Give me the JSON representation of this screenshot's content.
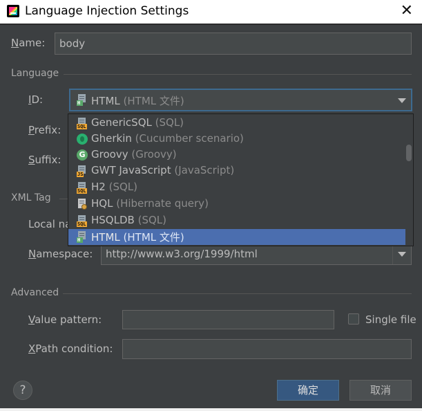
{
  "window": {
    "title": "Language Injection Settings"
  },
  "name": {
    "label": "Name:",
    "value": "body"
  },
  "language": {
    "section": "Language",
    "id_label": "ID:",
    "prefix_label": "Prefix:",
    "suffix_label": "Suffix:",
    "selected": {
      "name": "HTML",
      "hint": "(HTML 文件)"
    },
    "options": [
      {
        "name": "GenericSQL",
        "hint": "(SQL)",
        "icon": "sql-file-icon"
      },
      {
        "name": "Gherkin",
        "hint": "(Cucumber scenario)",
        "icon": "gherkin-icon"
      },
      {
        "name": "Groovy",
        "hint": "(Groovy)",
        "icon": "groovy-icon"
      },
      {
        "name": "GWT JavaScript",
        "hint": "(JavaScript)",
        "icon": "js-file-icon"
      },
      {
        "name": "H2",
        "hint": "(SQL)",
        "icon": "sql-file-icon"
      },
      {
        "name": "HQL",
        "hint": "(Hibernate query)",
        "icon": "hql-file-icon"
      },
      {
        "name": "HSQLDB",
        "hint": "(SQL)",
        "icon": "sql-file-icon"
      },
      {
        "name": "HTML",
        "hint": "(HTML 文件)",
        "icon": "html-file-icon"
      }
    ]
  },
  "xml_tag": {
    "section": "XML Tag",
    "local_name_label": "Local na",
    "namespace_label": "Namespace:",
    "namespace_value": "http://www.w3.org/1999/html"
  },
  "advanced": {
    "section": "Advanced",
    "value_pattern_label": "Value pattern:",
    "single_file_label": "Single file",
    "xpath_label": "XPath condition:"
  },
  "buttons": {
    "ok": "确定",
    "cancel": "取消",
    "help": "?"
  }
}
